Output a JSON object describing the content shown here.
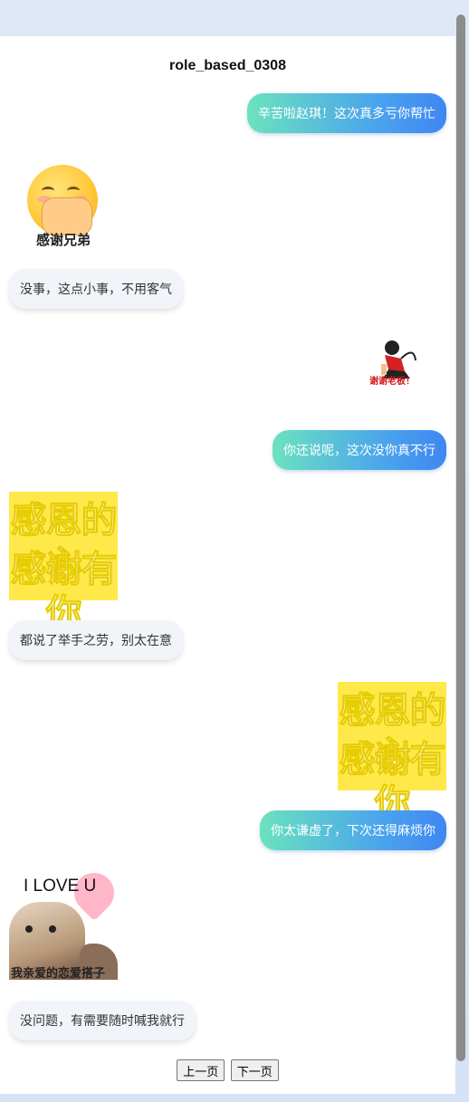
{
  "title": "role_based_0308",
  "messages": [
    {
      "type": "text",
      "side": "right",
      "text": "辛苦啦赵琪！这次真多亏你帮忙"
    },
    {
      "type": "sticker",
      "side": "left",
      "caption": "感谢兄弟"
    },
    {
      "type": "text",
      "side": "left",
      "text": "没事，这点小事，不用客气"
    },
    {
      "type": "sticker",
      "side": "right",
      "caption": "谢谢老板！"
    },
    {
      "type": "text",
      "side": "right",
      "text": "你还说呢，这次没你真不行"
    },
    {
      "type": "sticker",
      "side": "left",
      "lines": [
        "感恩的心",
        "感谢有你"
      ]
    },
    {
      "type": "text",
      "side": "left",
      "text": "都说了举手之劳，别太在意"
    },
    {
      "type": "sticker",
      "side": "right",
      "lines": [
        "感恩的心",
        "感谢有你"
      ]
    },
    {
      "type": "text",
      "side": "right",
      "text": "你太谦虚了，下次还得麻烦你"
    },
    {
      "type": "sticker",
      "side": "left",
      "top_text": "I LOVE U",
      "caption": "我亲爱的恋爱搭子"
    },
    {
      "type": "text",
      "side": "left",
      "text": "没问题，有需要随时喊我就行"
    }
  ],
  "pager": {
    "prev_label": "上一页",
    "next_label": "下一页"
  },
  "colors": {
    "bubble_right_start": "#6be2bf",
    "bubble_right_end": "#3f86f2",
    "bubble_left": "#f1f4f8",
    "sticker_yellow": "#ffe94a"
  }
}
